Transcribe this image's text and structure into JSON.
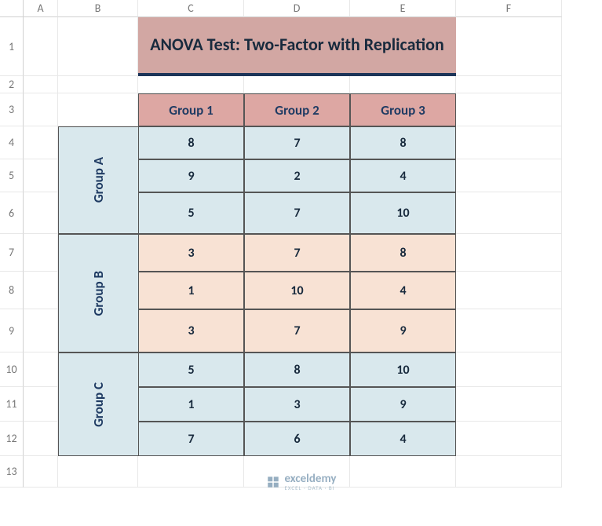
{
  "column_letters": [
    "A",
    "B",
    "C",
    "D",
    "E",
    "F"
  ],
  "row_numbers": [
    "1",
    "2",
    "3",
    "4",
    "5",
    "6",
    "7",
    "8",
    "9",
    "10",
    "11",
    "12",
    "13"
  ],
  "title": "ANOVA Test: Two-Factor with Replication",
  "col_headers": [
    "Group 1",
    "Group 2",
    "Group 3"
  ],
  "row_groups": [
    "Group A",
    "Group B",
    "Group C"
  ],
  "data": {
    "A": [
      [
        8,
        7,
        8
      ],
      [
        9,
        2,
        4
      ],
      [
        5,
        7,
        10
      ]
    ],
    "B": [
      [
        3,
        7,
        8
      ],
      [
        1,
        10,
        4
      ],
      [
        3,
        7,
        9
      ]
    ],
    "C": [
      [
        5,
        8,
        10
      ],
      [
        1,
        3,
        9
      ],
      [
        7,
        6,
        4
      ]
    ]
  },
  "watermark": {
    "name": "exceldemy",
    "tagline": "EXCEL · DATA · BI"
  }
}
